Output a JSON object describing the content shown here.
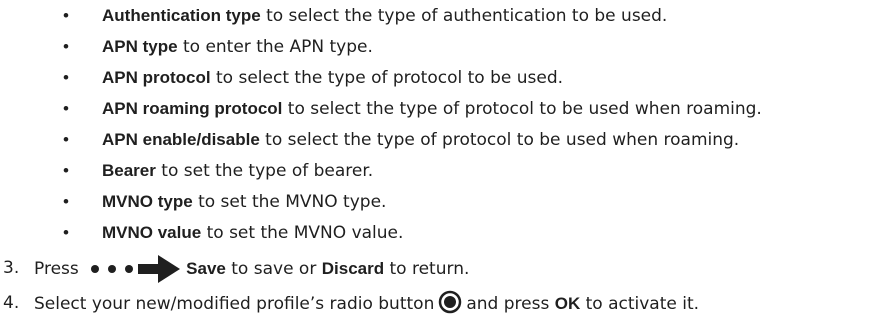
{
  "bullet_items": [
    {
      "bullet": "•",
      "term": "Authentication type",
      "text": " to select the type of authentication to be used."
    },
    {
      "bullet": "•",
      "term": "APN type",
      "text": " to enter the APN type."
    },
    {
      "bullet": "•",
      "term": "APN protocol",
      "text": " to select the type of protocol to be used."
    },
    {
      "bullet": "•",
      "term": "APN roaming protocol",
      "text": " to select the type of protocol to be used when roaming."
    },
    {
      "bullet": "•",
      "term": "APN enable/disable",
      "text": " to select the type of protocol to be used when roaming."
    },
    {
      "bullet": "•",
      "term": "Bearer",
      "text": " to set the type of bearer."
    },
    {
      "bullet": "•",
      "term": "MVNO type",
      "text": " to set the MVNO type."
    },
    {
      "bullet": "•",
      "term": "MVNO value",
      "text": " to set the MVNO value."
    }
  ],
  "steps": {
    "step3": {
      "number": "3.",
      "prefix": "Press ",
      "icons": [
        "more-options-icon",
        "right-arrow-icon"
      ],
      "save_label": "Save",
      "middle": " to save or ",
      "discard_label": "Discard",
      "suffix": " to return."
    },
    "step4": {
      "number": "4.",
      "prefix": "Select your new/modified profile’s radio button",
      "icon": "radio-selected-icon",
      "middle": "and press ",
      "ok_label": "OK",
      "suffix": " to activate it."
    }
  },
  "colors": {
    "text": "#1f1f1f"
  }
}
